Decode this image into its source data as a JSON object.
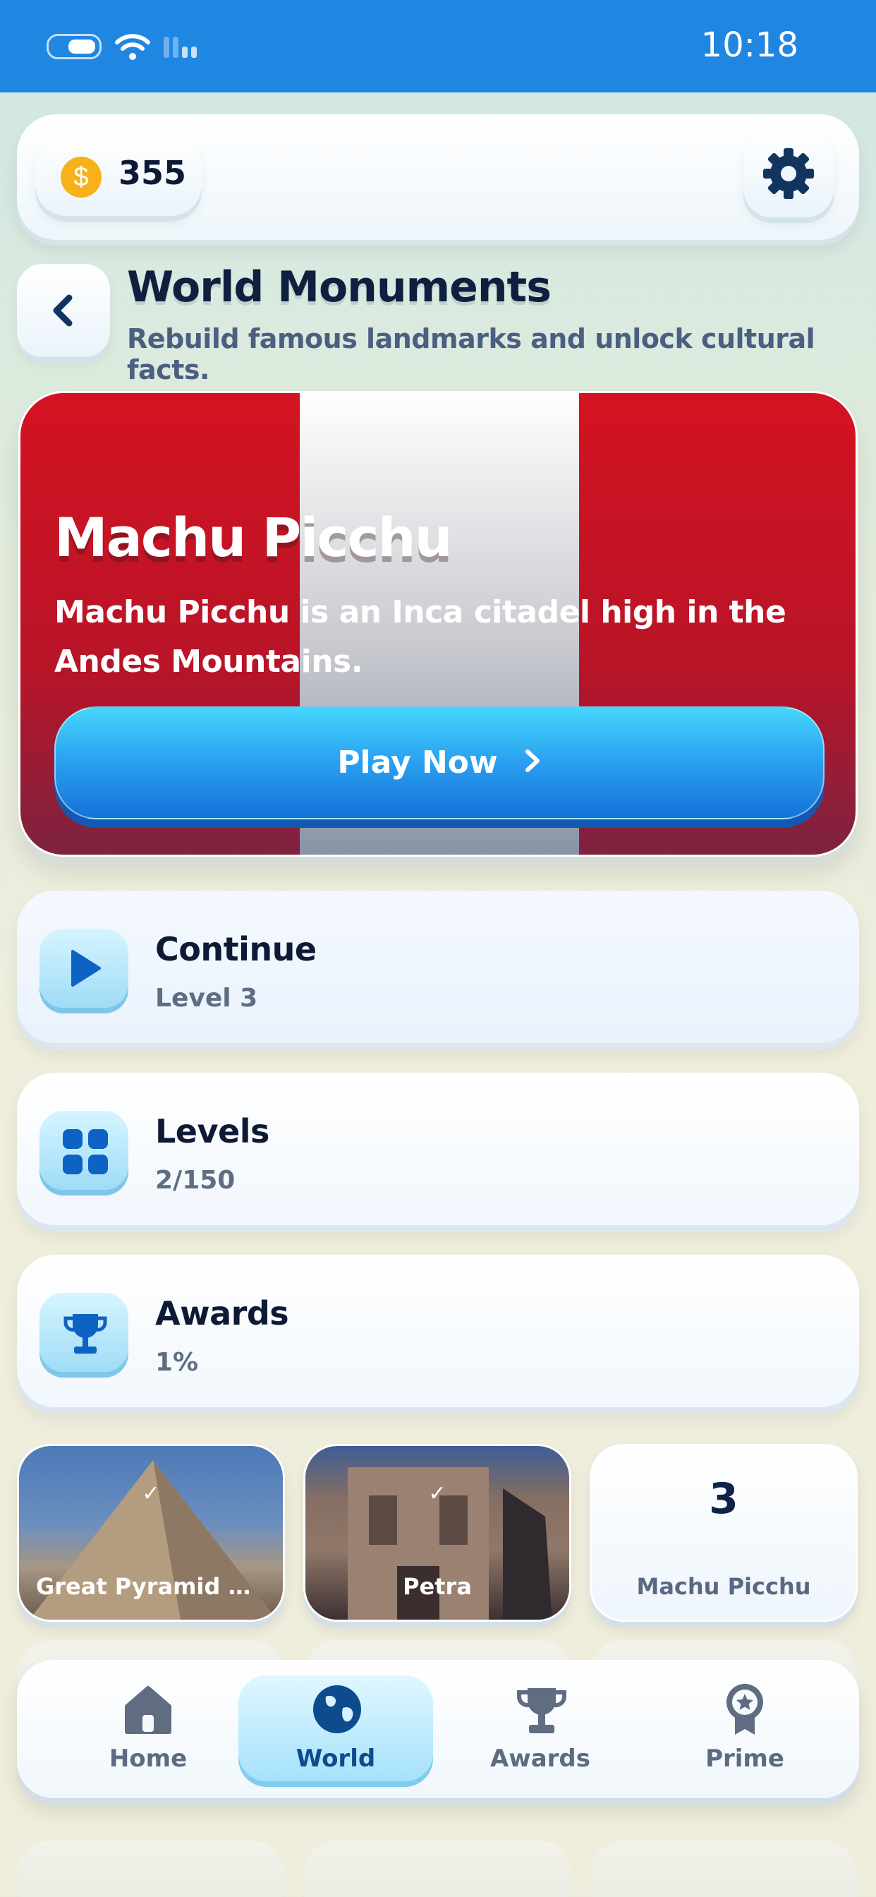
{
  "status_bar": {
    "time": "10:18"
  },
  "header": {
    "coins": "355"
  },
  "page": {
    "title": "World Monuments",
    "subtitle": "Rebuild famous landmarks and unlock cultural facts."
  },
  "hero": {
    "title": "Machu Picchu",
    "description": "Machu Picchu is an Inca citadel high in the Andes Mountains.",
    "play_label": "Play Now"
  },
  "menu": [
    {
      "title": "Continue",
      "subtitle": "Level 3",
      "icon": "play-icon"
    },
    {
      "title": "Levels",
      "subtitle": "2/150",
      "icon": "grid-icon"
    },
    {
      "title": "Awards",
      "subtitle": "1%",
      "icon": "trophy-icon"
    }
  ],
  "monuments": [
    {
      "label": "Great Pyramid o…",
      "completed": true
    },
    {
      "label": "Petra",
      "completed": true
    },
    {
      "label": "Machu Picchu",
      "number": "3",
      "completed": false
    }
  ],
  "tabbar": {
    "items": [
      {
        "label": "Home",
        "icon": "home-icon"
      },
      {
        "label": "World",
        "icon": "globe-icon",
        "active": true
      },
      {
        "label": "Awards",
        "icon": "trophy-icon"
      },
      {
        "label": "Prime",
        "icon": "badge-icon"
      }
    ]
  },
  "colors": {
    "status_bar": "#1f86e2",
    "accent_blue": "#1f86e2",
    "flag_red": "#d41322",
    "text_dark": "#0e1a35"
  }
}
